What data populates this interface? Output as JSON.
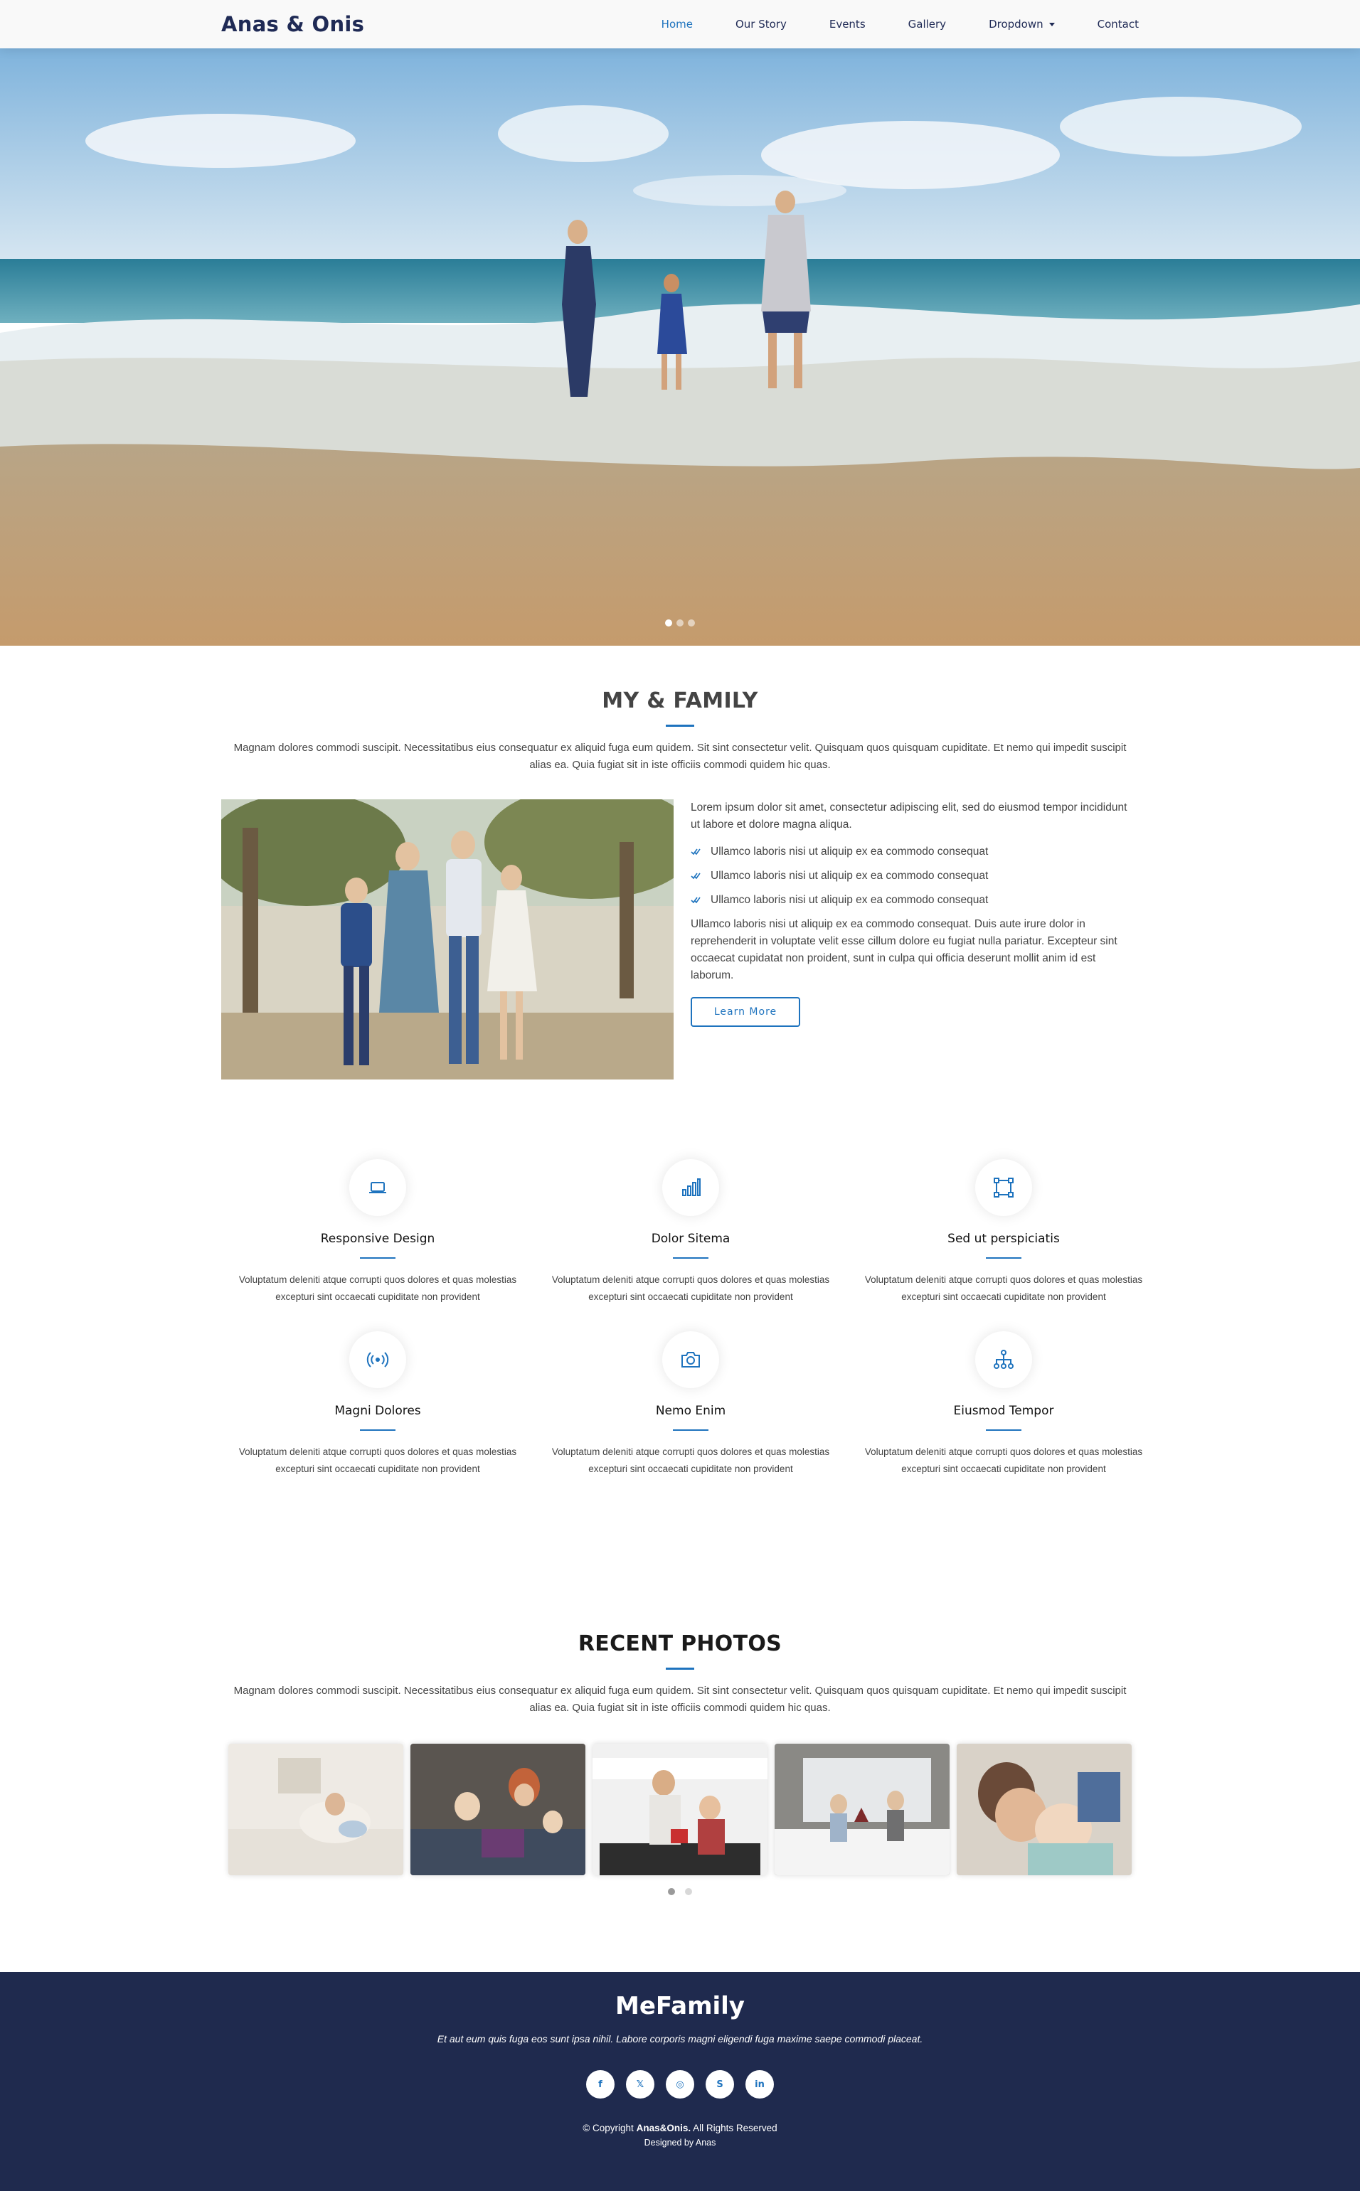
{
  "header": {
    "logo": "Anas & Onis",
    "nav": [
      {
        "label": "Home",
        "active": true
      },
      {
        "label": "Our Story"
      },
      {
        "label": "Events"
      },
      {
        "label": "Gallery"
      },
      {
        "label": "Dropdown",
        "has_caret": true
      },
      {
        "label": "Contact"
      }
    ]
  },
  "hero": {
    "image": "family-on-beach-photo",
    "slide_count": 3,
    "active_slide": 1
  },
  "about": {
    "title": "MY & FAMILY",
    "lead": "Magnam dolores commodi suscipit. Necessitatibus eius consequatur ex aliquid fuga eum quidem. Sit sint consectetur velit. Quisquam quos quisquam cupiditate. Et nemo qui impedit suscipit alias ea. Quia fugiat sit in iste officiis commodi quidem hic quas.",
    "image": "family-walking-photo",
    "intro": "Lorem ipsum dolor sit amet, consectetur adipiscing elit, sed do eiusmod tempor incididunt ut labore et dolore magna aliqua.",
    "bullets": [
      "Ullamco laboris nisi ut aliquip ex ea commodo consequat",
      "Ullamco laboris nisi ut aliquip ex ea commodo consequat",
      "Ullamco laboris nisi ut aliquip ex ea commodo consequat"
    ],
    "body": "Ullamco laboris nisi ut aliquip ex ea commodo consequat. Duis aute irure dolor in reprehenderit in voluptate velit esse cillum dolore eu fugiat nulla pariatur. Excepteur sint occaecat cupidatat non proident, sunt in culpa qui officia deserunt mollit anim id est laborum.",
    "button": "Learn More"
  },
  "services": [
    {
      "icon": "laptop-icon",
      "title": "Responsive Design",
      "desc": "Voluptatum deleniti atque corrupti quos dolores et quas molestias excepturi sint occaecati cupiditate non provident"
    },
    {
      "icon": "bar-chart-icon",
      "title": "Dolor Sitema",
      "desc": "Voluptatum deleniti atque corrupti quos dolores et quas molestias excepturi sint occaecati cupiditate non provident"
    },
    {
      "icon": "bounding-box-icon",
      "title": "Sed ut perspiciatis",
      "desc": "Voluptatum deleniti atque corrupti quos dolores et quas molestias excepturi sint occaecati cupiditate non provident"
    },
    {
      "icon": "broadcast-icon",
      "title": "Magni Dolores",
      "desc": "Voluptatum deleniti atque corrupti quos dolores et quas molestias excepturi sint occaecati cupiditate non provident"
    },
    {
      "icon": "camera-icon",
      "title": "Nemo Enim",
      "desc": "Voluptatum deleniti atque corrupti quos dolores et quas molestias excepturi sint occaecati cupiditate non provident"
    },
    {
      "icon": "diagram-icon",
      "title": "Eiusmod Tempor",
      "desc": "Voluptatum deleniti atque corrupti quos dolores et quas molestias excepturi sint occaecati cupiditate non provident"
    }
  ],
  "photos": {
    "title": "RECENT PHOTOS",
    "lead": "Magnam dolores commodi suscipit. Necessitatibus eius consequatur ex aliquid fuga eum quidem. Sit sint consectetur velit. Quisquam quos quisquam cupiditate. Et nemo qui impedit suscipit alias ea. Quia fugiat sit in iste officiis commodi quidem hic quas.",
    "items": [
      "mother-baby-photo",
      "mother-kids-laptop-photo",
      "couple-kitchen-photo",
      "kids-pillow-fight-photo",
      "father-baby-book-photo"
    ],
    "page_count": 2,
    "active_page": 1
  },
  "footer": {
    "brand": "MeFamily",
    "tagline": "Et aut eum quis fuga eos sunt ipsa nihil. Labore corporis magni eligendi fuga maxime saepe commodi placeat.",
    "social": [
      {
        "icon": "facebook-icon",
        "glyph": "f"
      },
      {
        "icon": "x-twitter-icon",
        "glyph": "𝕏"
      },
      {
        "icon": "instagram-icon",
        "glyph": "◎"
      },
      {
        "icon": "skype-icon",
        "glyph": "S"
      },
      {
        "icon": "linkedin-icon",
        "glyph": "in"
      }
    ],
    "copyright_prefix": "© Copyright",
    "copyright_brand": "Anas&Onis.",
    "copyright_suffix": "All Rights Reserved",
    "designed_by": "Designed by Anas"
  },
  "colors": {
    "accent": "#1e73be",
    "navy": "#1f2a4e",
    "text": "#444444"
  }
}
